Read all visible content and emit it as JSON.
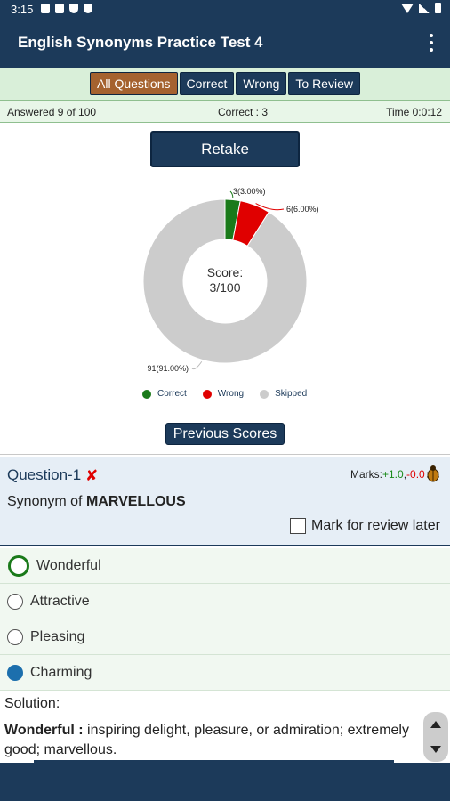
{
  "status_bar": {
    "time": "3:15"
  },
  "app_bar": {
    "title": "English Synonyms Practice Test 4",
    "menu_icon": "more-vert-icon"
  },
  "tabs": [
    {
      "label": "All Questions",
      "active": true
    },
    {
      "label": "Correct",
      "active": false
    },
    {
      "label": "Wrong",
      "active": false
    },
    {
      "label": "To Review",
      "active": false
    }
  ],
  "info": {
    "answered": "Answered 9 of 100",
    "correct": "Correct : 3",
    "time": "Time 0:0:12"
  },
  "retake_label": "Retake",
  "chart_data": {
    "type": "pie",
    "categories": [
      "Correct",
      "Wrong",
      "Skipped"
    ],
    "values": [
      3,
      6,
      91
    ],
    "slice_labels": [
      "3(3.00%)",
      "6(6.00%)",
      "91(91.00%)"
    ],
    "colors": [
      "#1a7a1a",
      "#e00000",
      "#cccccc"
    ],
    "center_title": "Score:",
    "center_value": "3/100",
    "legend": "bottom"
  },
  "previous_scores_label": "Previous Scores",
  "question": {
    "number": "Question-1",
    "status_icon": "wrong-cross-icon",
    "marks_label": "Marks:",
    "marks_plus": "+1.0",
    "marks_sep": ",",
    "marks_minus": "-0.0",
    "prompt_prefix": "Synonym of ",
    "prompt_word": "MARVELLOUS",
    "review_label": "Mark for review later",
    "options": [
      {
        "text": "Wonderful",
        "state": "correct"
      },
      {
        "text": "Attractive",
        "state": "none"
      },
      {
        "text": "Pleasing",
        "state": "none"
      },
      {
        "text": "Charming",
        "state": "selected"
      }
    ]
  },
  "solution": {
    "title": "Solution:",
    "term": "Wonderful :",
    "text": " inspiring delight, pleasure, or admiration; extremely good; marvellous."
  }
}
